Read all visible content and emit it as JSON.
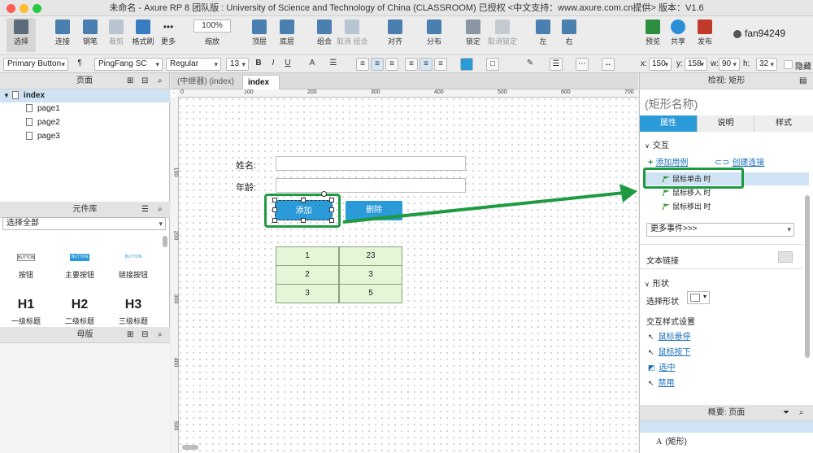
{
  "window": {
    "title": "未命名 - Axure RP 8 团队版 : University of Science and Technology of China (CLASSROOM) 已授权   <中文支持：www.axure.com.cn提供> 版本：V1.6"
  },
  "toolbar": {
    "select": "选择",
    "connect": "连接",
    "pen": "钢笔",
    "crop": "裁剪",
    "format_painter": "格式刷",
    "more": "更多",
    "zoom_value": "100%",
    "zoom": "缩放",
    "top_layer": "顶层",
    "bottom_layer": "底层",
    "group": "组合",
    "ungroup": "取消 组合",
    "align": "对齐",
    "distribute": "分布",
    "lock": "锁定",
    "unlock": "取消锁定",
    "left": "左",
    "right": "右",
    "preview": "预览",
    "share": "共享",
    "publish": "发布",
    "user": "fan94249"
  },
  "formatbar": {
    "style": "Primary Button",
    "font": "PingFang SC",
    "weight": "Regular",
    "size": "13",
    "x_label": "x:",
    "x": "150",
    "y_label": "y:",
    "y": "158",
    "w_label": "w:",
    "w": "90",
    "h_label": "h:",
    "h": "32",
    "hidden": "隐藏"
  },
  "pages": {
    "title": "页面",
    "root": "index",
    "items": [
      "page1",
      "page2",
      "page3"
    ]
  },
  "library": {
    "title": "元件库",
    "select_all": "选择全部",
    "widgets": [
      {
        "preview": "BUTTON",
        "label": "按钮"
      },
      {
        "preview": "BUTTON",
        "label": "主要按钮"
      },
      {
        "preview": "BUTTON",
        "label": "链接按钮"
      },
      {
        "preview": "H1",
        "label": "一级标题"
      },
      {
        "preview": "H2",
        "label": "二级标题"
      },
      {
        "preview": "H3",
        "label": "三级标题"
      }
    ]
  },
  "masters": {
    "title": "母版"
  },
  "tabs": [
    {
      "label": "(中继器) (index)"
    },
    {
      "label": "index",
      "close": "✕"
    }
  ],
  "ruler": {
    "h": [
      "0",
      "100",
      "200",
      "300",
      "400",
      "500",
      "600",
      "700"
    ],
    "v": [
      "100",
      "200",
      "300",
      "400",
      "500"
    ]
  },
  "canvas": {
    "name_label": "姓名:",
    "age_label": "年龄:",
    "add_button": "添加",
    "delete_button": "删除",
    "table": [
      [
        "1",
        "23"
      ],
      [
        "2",
        "3"
      ],
      [
        "3",
        "5"
      ]
    ]
  },
  "inspector": {
    "title": "检视: 矩形",
    "shape_name": "(矩形名称)",
    "tabs": [
      "属性",
      "说明",
      "样式"
    ],
    "interaction": "交互",
    "add_case": "添加用例",
    "create_link": "创建连接",
    "events": [
      "鼠标单击 时",
      "鼠标移入 时",
      "鼠标移出 时"
    ],
    "more_events": "更多事件>>>",
    "text_link": "文本链接",
    "shape_section": "形状",
    "select_shape": "选择形状",
    "interaction_styles": "交互样式设置",
    "styles": [
      "鼠标悬停",
      "鼠标按下",
      "选中",
      "禁用"
    ],
    "outline_title": "概要: 页面",
    "outline_items": [
      "(矩形)"
    ]
  },
  "colors": {
    "accent": "#2a9ad8",
    "highlight": "#1f9a40",
    "cell": "#e3f6d8"
  }
}
